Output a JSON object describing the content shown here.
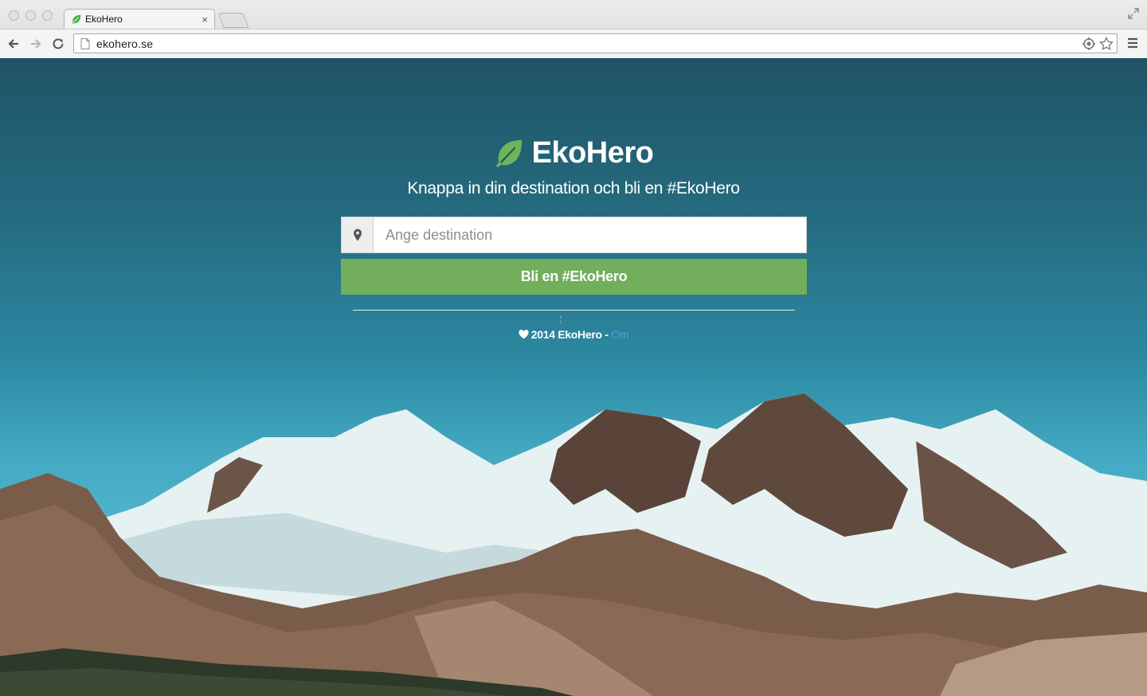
{
  "browser": {
    "tab_title": "EkoHero",
    "tab_close": "×",
    "url": "ekohero.se"
  },
  "page": {
    "brand_name": "EkoHero",
    "tagline": "Knappa in din destination och bli en #EkoHero",
    "search_placeholder": "Ange destination",
    "cta_label": "Bli en #EkoHero",
    "footer_text": "2014 EkoHero - ",
    "footer_link": "Om"
  },
  "icons": {
    "leaf": "leaf-icon",
    "location": "map-marker-icon",
    "heart": "heart-icon"
  },
  "colors": {
    "brand_green": "#72ae5b",
    "leaf_green": "#6fb35b",
    "link_blue": "#4aa0d8",
    "sky_top": "#1f5466",
    "sky_bottom": "#52b6cd"
  }
}
